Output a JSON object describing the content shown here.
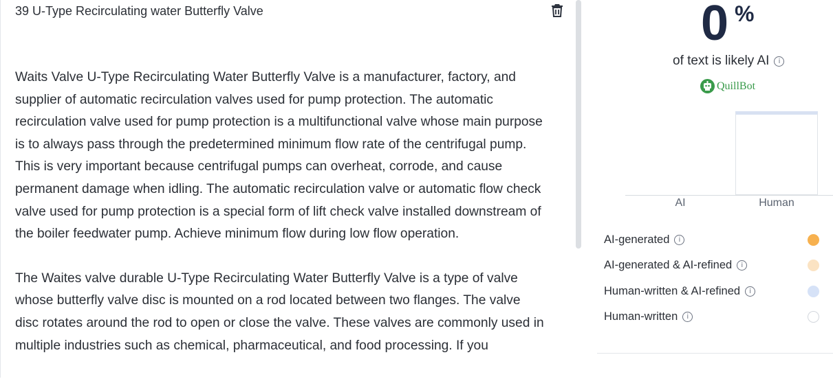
{
  "document": {
    "title": "39 U-Type Recirculating water Butterfly Valve",
    "paragraphs": [
      "Waits Valve U-Type Recirculating Water Butterfly Valve is a manufacturer, factory, and supplier of automatic recirculation valves used for pump protection. The automatic recirculation valve used for pump protection is a multifunctional valve whose main purpose is to always pass through the predetermined minimum flow rate of the centrifugal pump. This is very important because centrifugal pumps can overheat, corrode, and cause permanent damage when idling. The automatic recirculation valve or automatic flow check valve used for pump protection is a special form of lift check valve installed downstream of the boiler feedwater pump. Achieve minimum flow during low flow operation.",
      "The Waites valve durable U-Type Recirculating Water Butterfly Valve is a type of valve whose butterfly valve disc is mounted on a rod located between two flanges. The valve disc rotates around the rod to open or close the valve. These valves are commonly used in multiple industries such as chemical, pharmaceutical, and food processing. If you"
    ],
    "delete_icon": "trash-icon"
  },
  "results": {
    "score": "0",
    "score_unit": "%",
    "caption": "of text is likely AI",
    "brand": "QuillBot",
    "chart_data": {
      "type": "bar",
      "categories": [
        "AI",
        "Human"
      ],
      "values": [
        0,
        100
      ],
      "colors": [
        "#f5ac4a",
        "#ffffff"
      ]
    },
    "legend": [
      {
        "label": "AI-generated",
        "color": "#f7b14f",
        "border": "#f7b14f"
      },
      {
        "label": "AI-generated & AI-refined",
        "color": "#fbe3c3",
        "border": "#fbe3c3"
      },
      {
        "label": "Human-written & AI-refined",
        "color": "#d6e2f7",
        "border": "#d6e2f7"
      },
      {
        "label": "Human-written",
        "color": "#ffffff",
        "border": "#d3d7dd"
      }
    ]
  }
}
